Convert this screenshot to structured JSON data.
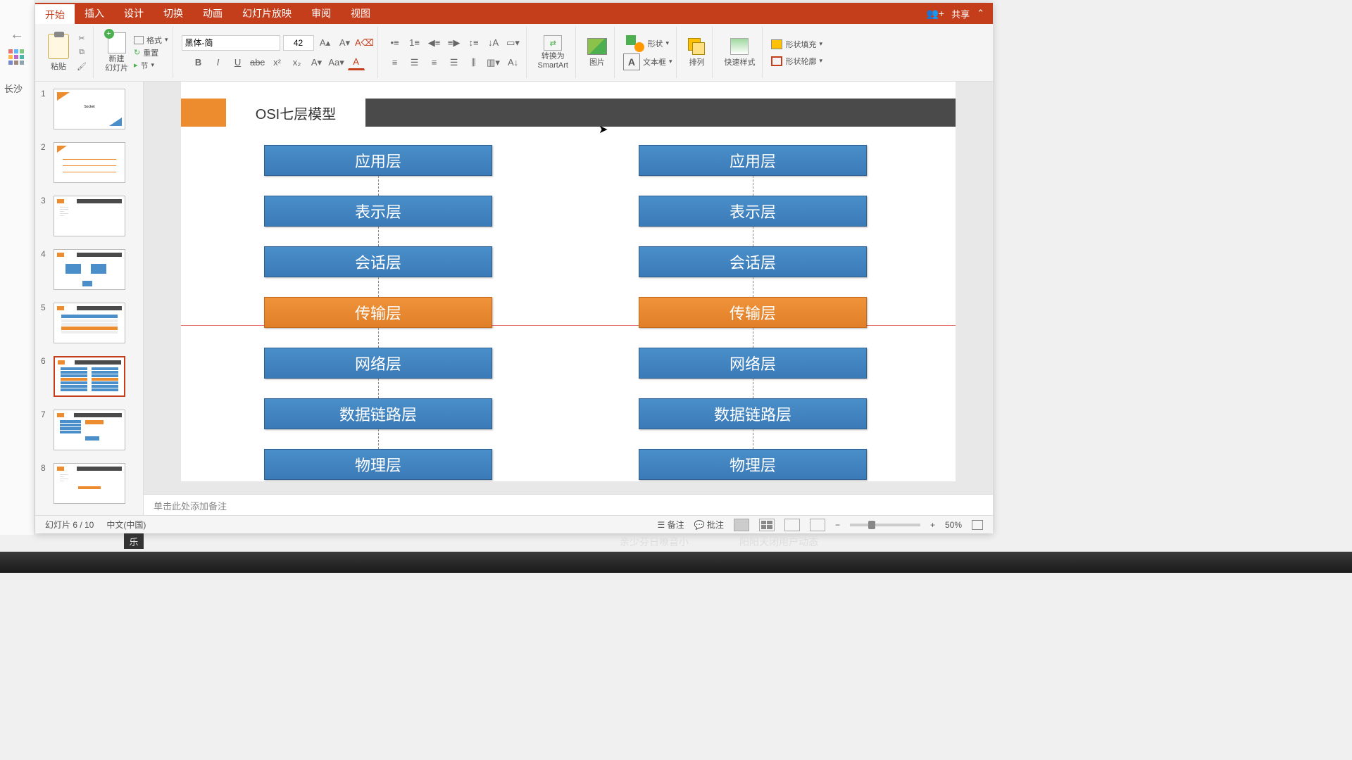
{
  "tabs": {
    "home": "开始",
    "insert": "插入",
    "design": "设计",
    "transitions": "切换",
    "animations": "动画",
    "slideshow": "幻灯片放映",
    "review": "审阅",
    "view": "视图"
  },
  "share": "共享",
  "ribbon": {
    "paste": "粘贴",
    "format": "格式",
    "reset": "重置",
    "section": "节",
    "newslide": "新建\n幻灯片",
    "font": "黑体-简",
    "size": "42",
    "smartart": "转换为\nSmartArt",
    "picture": "图片",
    "textbox": "文本框",
    "shapes": "形状",
    "arrange": "排列",
    "quickstyle": "快速样式",
    "fill": "形状填充",
    "outline": "形状轮廓"
  },
  "leftEdge": "长沙",
  "slide": {
    "title": "OSI七层模型",
    "layers": [
      "应用层",
      "表示层",
      "会话层",
      "传输层",
      "网络层",
      "数据链路层",
      "物理层"
    ]
  },
  "notes_placeholder": "单击此处添加备注",
  "status": {
    "slide": "幻灯片 6 / 10",
    "lang": "中文(中国)",
    "notes": "备注",
    "comments": "批注",
    "zoom": "50%"
  },
  "strip": {
    "t1": "亲少芬日嘹音小",
    "t2": "阳阳天闭用户动态",
    "tile": "乐"
  },
  "thumbs": [
    1,
    2,
    3,
    4,
    5,
    6,
    7,
    8
  ]
}
